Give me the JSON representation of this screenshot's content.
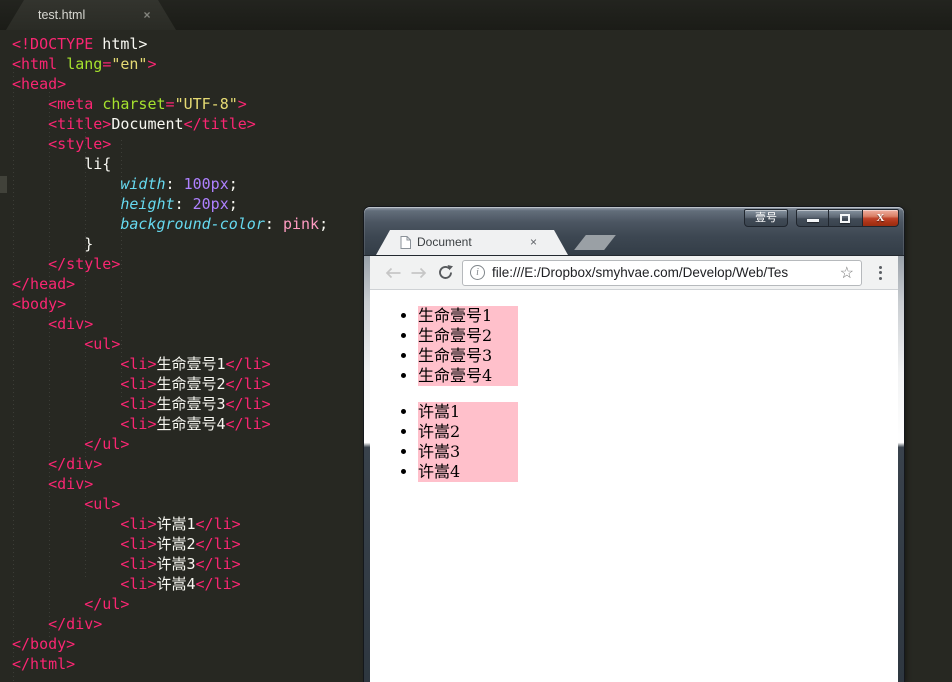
{
  "editor": {
    "tab": {
      "filename": "test.html",
      "close_glyph": "×"
    },
    "palette": {
      "background": "#272822",
      "tag": "#f92672",
      "attribute": "#a6e22e",
      "string": "#e6db74",
      "css_property": "#66d9ef",
      "number": "#ae81ff",
      "pink_value": "#ff9bc2",
      "text": "#f8f8f2"
    },
    "code_lines": [
      [
        [
          "tag",
          "<!DOCTYPE"
        ],
        [
          "plain",
          " html>"
        ]
      ],
      [
        [
          "tag",
          "<html "
        ],
        [
          "attr",
          "lang"
        ],
        [
          "tag",
          "="
        ],
        [
          "str",
          "\"en\""
        ],
        [
          "tag",
          ">"
        ]
      ],
      [
        [
          "tag",
          "<head>"
        ]
      ],
      [
        [
          "plain",
          "    "
        ],
        [
          "tag",
          "<meta "
        ],
        [
          "attr",
          "charset"
        ],
        [
          "tag",
          "="
        ],
        [
          "str",
          "\"UTF-8\""
        ],
        [
          "tag",
          ">"
        ]
      ],
      [
        [
          "plain",
          "    "
        ],
        [
          "tag",
          "<title>"
        ],
        [
          "plain",
          "Document"
        ],
        [
          "tag",
          "</title>"
        ]
      ],
      [
        [
          "plain",
          "    "
        ],
        [
          "tag",
          "<style>"
        ]
      ],
      [
        [
          "plain",
          "        li{"
        ]
      ],
      [
        [
          "plain",
          "            "
        ],
        [
          "prop",
          "width"
        ],
        [
          "plain",
          ": "
        ],
        [
          "num",
          "100px"
        ],
        [
          "plain",
          ";"
        ]
      ],
      [
        [
          "plain",
          "            "
        ],
        [
          "prop",
          "height"
        ],
        [
          "plain",
          ": "
        ],
        [
          "num",
          "20px"
        ],
        [
          "plain",
          ";"
        ]
      ],
      [
        [
          "plain",
          "            "
        ],
        [
          "prop",
          "background-color"
        ],
        [
          "plain",
          ": "
        ],
        [
          "pink",
          "pink"
        ],
        [
          "plain",
          ";"
        ]
      ],
      [
        [
          "plain",
          "        }"
        ]
      ],
      [
        [
          "plain",
          "    "
        ],
        [
          "tag",
          "</style>"
        ]
      ],
      [
        [
          "tag",
          "</head>"
        ]
      ],
      [
        [
          "tag",
          "<body>"
        ]
      ],
      [
        [
          "plain",
          "    "
        ],
        [
          "tag",
          "<div>"
        ]
      ],
      [
        [
          "plain",
          "        "
        ],
        [
          "tag",
          "<ul>"
        ]
      ],
      [
        [
          "plain",
          "            "
        ],
        [
          "tag",
          "<li>"
        ],
        [
          "plain",
          "生命壹号1"
        ],
        [
          "tag",
          "</li>"
        ]
      ],
      [
        [
          "plain",
          "            "
        ],
        [
          "tag",
          "<li>"
        ],
        [
          "plain",
          "生命壹号2"
        ],
        [
          "tag",
          "</li>"
        ]
      ],
      [
        [
          "plain",
          "            "
        ],
        [
          "tag",
          "<li>"
        ],
        [
          "plain",
          "生命壹号3"
        ],
        [
          "tag",
          "</li>"
        ]
      ],
      [
        [
          "plain",
          "            "
        ],
        [
          "tag",
          "<li>"
        ],
        [
          "plain",
          "生命壹号4"
        ],
        [
          "tag",
          "</li>"
        ]
      ],
      [
        [
          "plain",
          "        "
        ],
        [
          "tag",
          "</ul>"
        ]
      ],
      [
        [
          "plain",
          "    "
        ],
        [
          "tag",
          "</div>"
        ]
      ],
      [
        [
          "plain",
          "    "
        ],
        [
          "tag",
          "<div>"
        ]
      ],
      [
        [
          "plain",
          "        "
        ],
        [
          "tag",
          "<ul>"
        ]
      ],
      [
        [
          "plain",
          "            "
        ],
        [
          "tag",
          "<li>"
        ],
        [
          "plain",
          "许嵩1"
        ],
        [
          "tag",
          "</li>"
        ]
      ],
      [
        [
          "plain",
          "            "
        ],
        [
          "tag",
          "<li>"
        ],
        [
          "plain",
          "许嵩2"
        ],
        [
          "tag",
          "</li>"
        ]
      ],
      [
        [
          "plain",
          "            "
        ],
        [
          "tag",
          "<li>"
        ],
        [
          "plain",
          "许嵩3"
        ],
        [
          "tag",
          "</li>"
        ]
      ],
      [
        [
          "plain",
          "            "
        ],
        [
          "tag",
          "<li>"
        ],
        [
          "plain",
          "许嵩4"
        ],
        [
          "tag",
          "</li>"
        ]
      ],
      [
        [
          "plain",
          "        "
        ],
        [
          "tag",
          "</ul>"
        ]
      ],
      [
        [
          "plain",
          "    "
        ],
        [
          "tag",
          "</div>"
        ]
      ],
      [
        [
          "tag",
          "</body>"
        ]
      ],
      [
        [
          "tag",
          "</html>"
        ]
      ]
    ]
  },
  "browser": {
    "caption": {
      "app_label": "壹号",
      "close_glyph": "X"
    },
    "tab": {
      "title": "Document",
      "close_glyph": "×"
    },
    "toolbar": {
      "url": "file:///E:/Dropbox/smyhvae.com/Develop/Web/Tes",
      "star_glyph": "☆",
      "info_glyph": "i"
    },
    "page": {
      "li_background": "#ffc0cb",
      "lists": [
        {
          "items": [
            "生命壹号1",
            "生命壹号2",
            "生命壹号3",
            "生命壹号4"
          ]
        },
        {
          "items": [
            "许嵩1",
            "许嵩2",
            "许嵩3",
            "许嵩4"
          ]
        }
      ]
    }
  }
}
